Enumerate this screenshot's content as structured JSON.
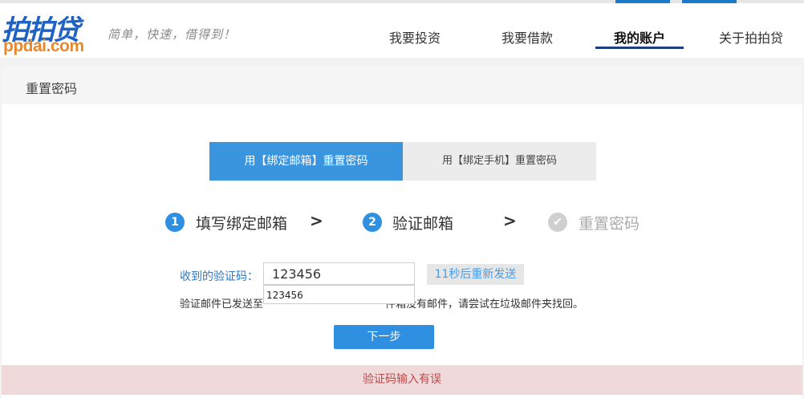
{
  "brand": {
    "logo_cn": "拍拍贷",
    "logo_en": "ppdai.com",
    "slogan": "简单，快速，借得到！",
    "accent": "#2f8fe0",
    "nav_underline_color": "#1a3f86"
  },
  "nav": {
    "items": [
      {
        "label": "我要投资"
      },
      {
        "label": "我要借款"
      },
      {
        "label": "我的账户",
        "active": true
      },
      {
        "label": "关于拍拍贷"
      }
    ]
  },
  "panel": {
    "title": "重置密码"
  },
  "tabs": [
    {
      "label": "用【绑定邮箱】重置密码",
      "active": true
    },
    {
      "label": "用【绑定手机】重置密码",
      "active": false
    }
  ],
  "steps": [
    {
      "number": "1",
      "label": "填写绑定邮箱",
      "state": "done"
    },
    {
      "number": "2",
      "label": "验证邮箱",
      "state": "current"
    },
    {
      "number": "",
      "label": "重置密码",
      "state": "pending"
    }
  ],
  "step_separator": ">",
  "form": {
    "code_label": "收到的验证码：",
    "code_value": "123456",
    "autocomplete_suggestion": "123456",
    "resend_label": "11秒后重新发送",
    "info_prefix": "验证邮件已发送至",
    "info_suffix": "件箱没有邮件，请尝试在垃圾邮件夹找回。",
    "next_label": "下一步"
  },
  "error": {
    "message": "验证码输入有误"
  }
}
